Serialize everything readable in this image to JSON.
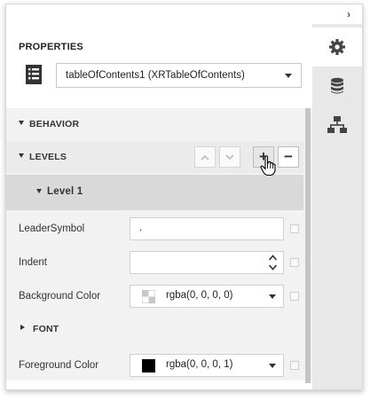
{
  "panel": {
    "title": "PROPERTIES",
    "selected_object": "tableOfContents1 (XRTableOfContents)"
  },
  "sidebar_tools": [
    {
      "icon": "gear-icon",
      "active": true
    },
    {
      "icon": "database-icon",
      "active": false
    },
    {
      "icon": "hierarchy-icon",
      "active": false
    }
  ],
  "sections": {
    "behavior": "BEHAVIOR",
    "levels": "LEVELS",
    "level1": "Level 1",
    "font": "FONT"
  },
  "properties": {
    "leader_symbol": {
      "label": "LeaderSymbol",
      "value": "."
    },
    "indent": {
      "label": "Indent",
      "value": ""
    },
    "background_color": {
      "label": "Background Color",
      "value": "rgba(0, 0, 0, 0)"
    },
    "foreground_color": {
      "label": "Foreground Color",
      "value": "rgba(0, 0, 0, 1)"
    }
  },
  "level_buttons": {
    "move_up": "up-arrow-icon",
    "move_down": "down-arrow-icon",
    "add": "+",
    "remove": "−"
  },
  "colors": {
    "panel_bg": "#f2f2f2",
    "level_header_bg": "#d9d9d9",
    "toolstrip_bg": "#e8e8e8",
    "foreground_swatch": "#000000"
  }
}
